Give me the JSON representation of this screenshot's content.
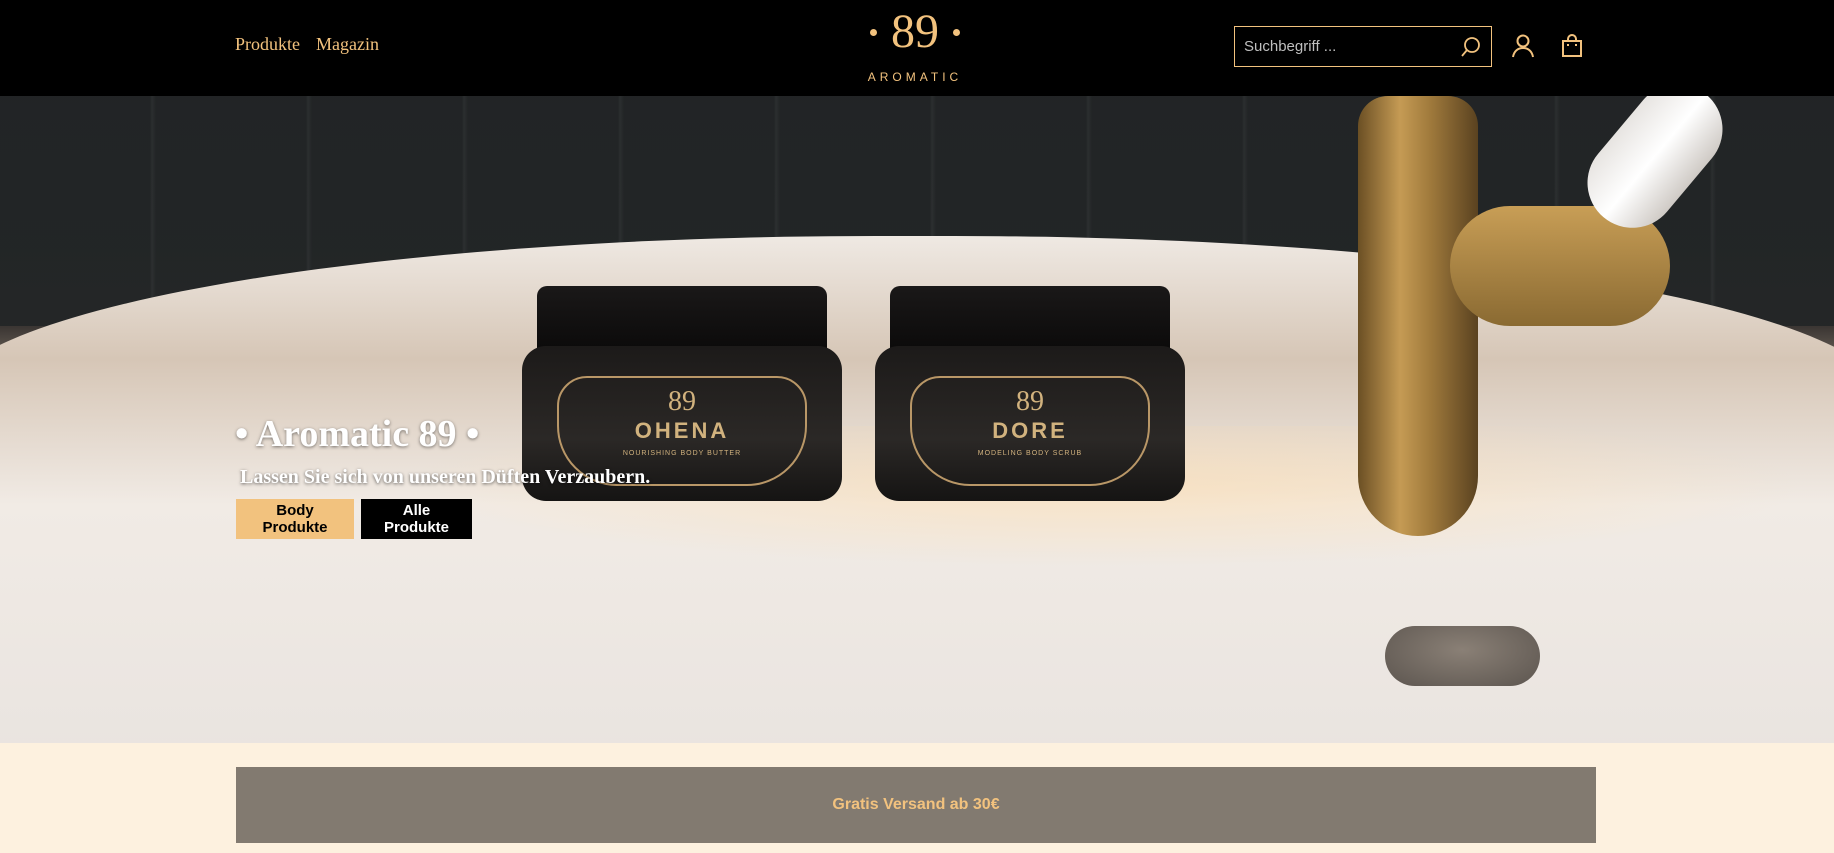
{
  "nav": {
    "items": [
      "Produkte",
      "Magazin"
    ]
  },
  "logo": {
    "number": "89",
    "subtitle": "AROMATIC"
  },
  "search": {
    "placeholder": "Suchbegriff ..."
  },
  "icons": {
    "search": "search-icon",
    "account": "user-icon",
    "cart": "shopping-bag-icon"
  },
  "hero": {
    "title": "• Aromatic 89 •",
    "subtitle": "Lassen Sie sich von unseren Düften Verzaubern.",
    "buttons": {
      "primary": "Body Produkte",
      "secondary": "Alle Produkte"
    },
    "jars": [
      {
        "number": "89",
        "name": "OHENA",
        "desc": "NOURISHING BODY BUTTER"
      },
      {
        "number": "89",
        "name": "DORE",
        "desc": "MODELING BODY SCRUB"
      }
    ]
  },
  "banner": {
    "text": "Gratis Versand ab 30€"
  },
  "colors": {
    "accent": "#f2c27e",
    "header_bg": "#000000",
    "page_bg": "#fdf1df",
    "banner_bg": "#827a70"
  }
}
